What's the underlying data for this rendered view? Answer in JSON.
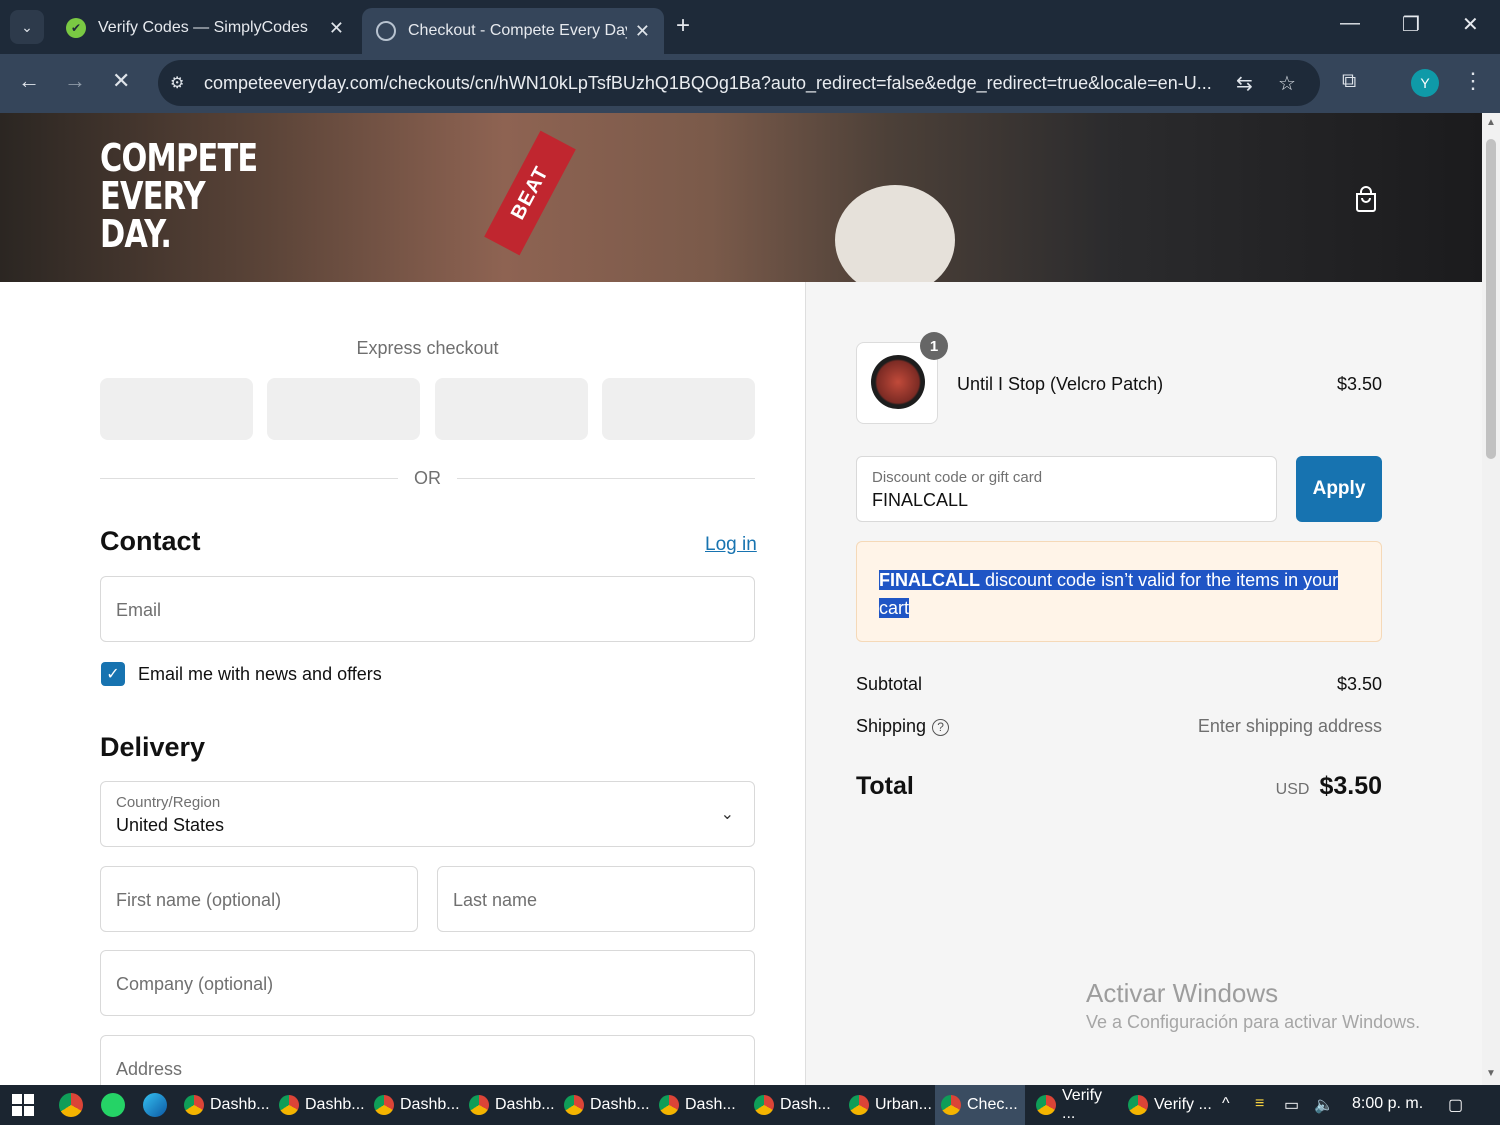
{
  "browser": {
    "tabs": [
      {
        "title": "Verify Codes — SimplyCodes",
        "active": false
      },
      {
        "title": "Checkout - Compete Every Day",
        "active": true
      }
    ],
    "url": "competeeveryday.com/checkouts/cn/hWN10kLpTsfBUzhQ1BQOg1Ba?auto_redirect=false&edge_redirect=true&locale=en-U...",
    "profile_initial": "Y"
  },
  "header": {
    "logo_lines": [
      "COMPETE",
      "EVERY",
      "DAY."
    ],
    "band_text": "BEAT"
  },
  "checkout": {
    "express_label": "Express checkout",
    "or_label": "OR",
    "contact_heading": "Contact",
    "login_link": "Log in",
    "email_placeholder": "Email",
    "newsletter_label": "Email me with news and offers",
    "newsletter_checked": true,
    "delivery_heading": "Delivery",
    "country_label": "Country/Region",
    "country_value": "United States",
    "first_name_placeholder": "First name (optional)",
    "last_name_placeholder": "Last name",
    "company_placeholder": "Company (optional)",
    "address_placeholder": "Address"
  },
  "summary": {
    "item": {
      "name": "Until I Stop (Velcro Patch)",
      "price": "$3.50",
      "quantity": "1"
    },
    "discount_label": "Discount code or gift card",
    "discount_value": "FINALCALL",
    "apply_label": "Apply",
    "error_code": "FINALCALL",
    "error_message": " discount code isn’t valid for the items in your cart",
    "subtotal_label": "Subtotal",
    "subtotal_value": "$3.50",
    "shipping_label": "Shipping",
    "shipping_value": "Enter shipping address",
    "total_label": "Total",
    "total_currency": "USD",
    "total_value": "$3.50"
  },
  "watermark": {
    "title": "Activar Windows",
    "subtitle": "Ve a Configuración para activar Windows."
  },
  "taskbar": {
    "items": [
      "Dashb...",
      "Dashb...",
      "Dashb...",
      "Dashb...",
      "Dashb...",
      "Dash...",
      "Dash...",
      "Urban...",
      "Chec...",
      "Verify ...",
      "Verify ..."
    ],
    "active_index": 8,
    "clock": "8:00 p. m."
  },
  "colors": {
    "accent": "#1773b0",
    "error_bg": "#fff4e8",
    "selection": "#1f55c5"
  }
}
